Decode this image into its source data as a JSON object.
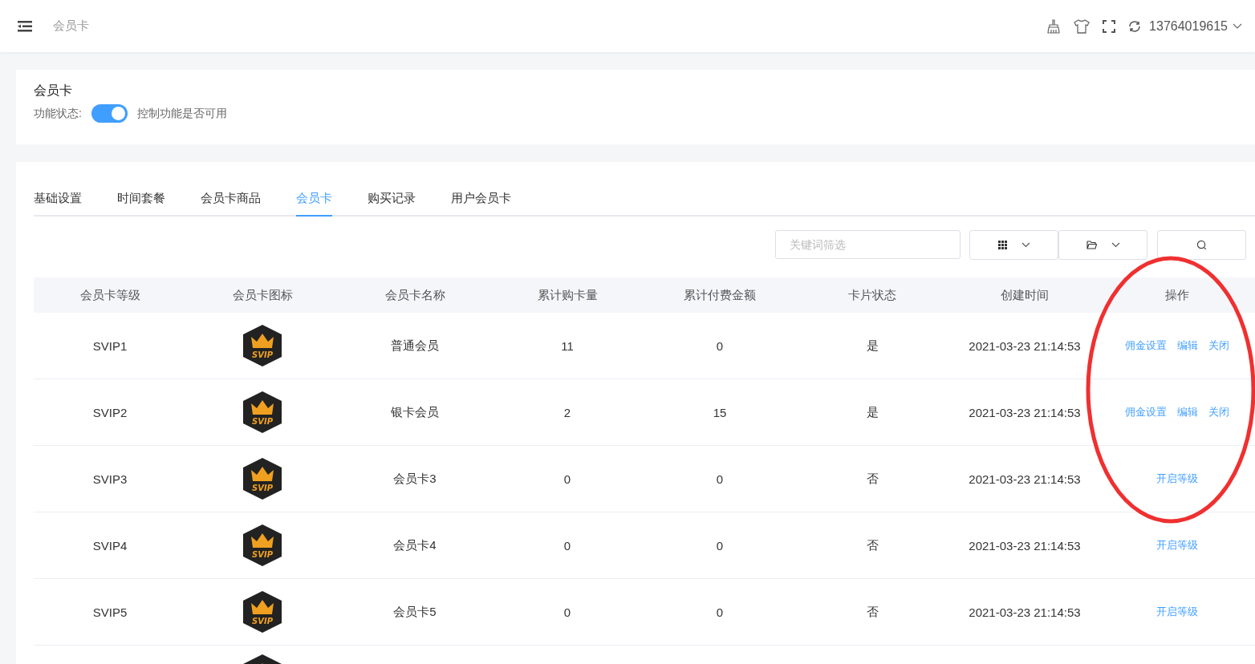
{
  "header": {
    "breadcrumb": "会员卡",
    "account": "13764019615"
  },
  "feature": {
    "title": "会员卡",
    "label": "功能状态:",
    "on": true,
    "hint": "控制功能是否可用"
  },
  "tabs": [
    {
      "label": "基础设置",
      "selected": false
    },
    {
      "label": "时间套餐",
      "selected": false
    },
    {
      "label": "会员卡商品",
      "selected": false
    },
    {
      "label": "会员卡",
      "selected": true
    },
    {
      "label": "购买记录",
      "selected": false
    },
    {
      "label": "用户会员卡",
      "selected": false
    }
  ],
  "search": {
    "placeholder": "关键词筛选"
  },
  "table": {
    "columns": [
      "会员卡等级",
      "会员卡图标",
      "会员卡名称",
      "累计购卡量",
      "累计付费金额",
      "卡片状态",
      "创建时间",
      "操作"
    ],
    "rows": [
      {
        "level": "SVIP1",
        "badge": "SVIP",
        "name": "普通会员",
        "count": "11",
        "amount": "0",
        "status": "是",
        "created": "2021-03-23 21:14:53",
        "actions": [
          "佣金设置",
          "编辑",
          "关闭"
        ]
      },
      {
        "level": "SVIP2",
        "badge": "SVIP",
        "name": "银卡会员",
        "count": "2",
        "amount": "15",
        "status": "是",
        "created": "2021-03-23 21:14:53",
        "actions": [
          "佣金设置",
          "编辑",
          "关闭"
        ]
      },
      {
        "level": "SVIP3",
        "badge": "SVIP",
        "name": "会员卡3",
        "count": "0",
        "amount": "0",
        "status": "否",
        "created": "2021-03-23 21:14:53",
        "actions": [
          "开启等级"
        ]
      },
      {
        "level": "SVIP4",
        "badge": "SVIP",
        "name": "会员卡4",
        "count": "0",
        "amount": "0",
        "status": "否",
        "created": "2021-03-23 21:14:53",
        "actions": [
          "开启等级"
        ]
      },
      {
        "level": "SVIP5",
        "badge": "SVIP",
        "name": "会员卡5",
        "count": "0",
        "amount": "0",
        "status": "否",
        "created": "2021-03-23 21:14:53",
        "actions": [
          "开启等级"
        ]
      }
    ],
    "more_rows_below": true
  },
  "annotation": {
    "kind": "ellipse"
  }
}
